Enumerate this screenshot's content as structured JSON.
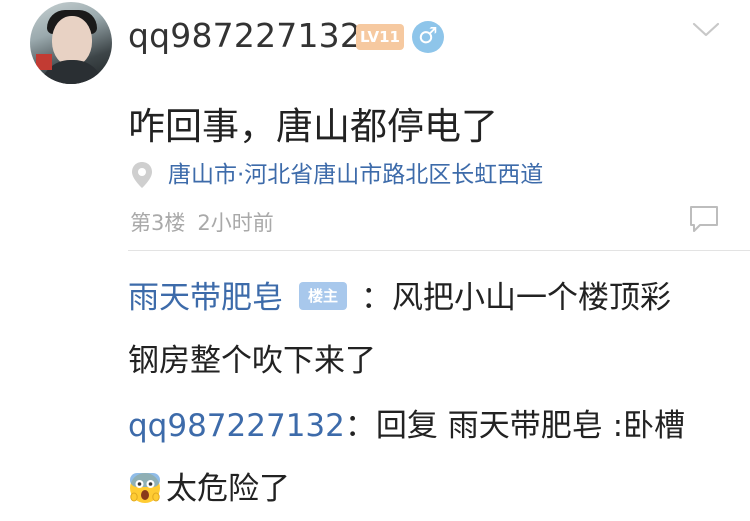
{
  "post": {
    "username": "qq987227132",
    "level_badge": "LV11",
    "gender_symbol": "♂",
    "content": "咋回事，唐山都停电了",
    "location": "唐山市·河北省唐山市路北区长虹西道",
    "floor": "第3楼",
    "time": "2小时前"
  },
  "replies": [
    {
      "author": "雨天带肥皂",
      "badge": "楼主",
      "text_line1": "：风把小山一个楼顶彩",
      "text_line2": "钢房整个吹下来了"
    },
    {
      "author": "qq987227132",
      "text_line1": "：回复 雨天带肥皂 :卧槽",
      "text_line2": "太危险了"
    }
  ],
  "icons": {
    "gender": "male-icon",
    "more": "chevron-down-icon",
    "location": "location-pin-icon",
    "reply": "comment-icon",
    "emoji": "scared-face-emoji-icon"
  },
  "colors": {
    "link_blue": "#3d6baa",
    "level_badge_bg": "#f6c9a0",
    "host_badge_bg": "#a8c8ec",
    "gender_bg": "#8ec5ea",
    "meta_gray": "#a9a9a9"
  }
}
